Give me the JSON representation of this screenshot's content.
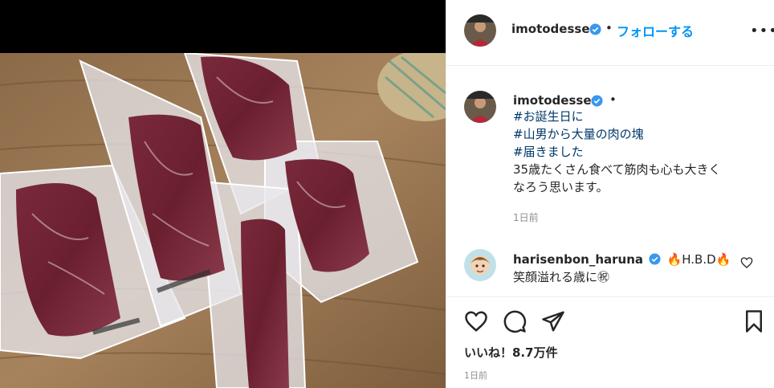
{
  "post": {
    "username": "imotodesse",
    "follow_label": "フォローする",
    "separator": "•",
    "more_label": "•••"
  },
  "caption": {
    "username": "imotodesse",
    "separator": "•",
    "hashtags": [
      "#お誕生日に",
      "#山男から大量の肉の塊",
      "#届きました"
    ],
    "body_lines": [
      "35歳たくさん食べて筋肉も心も大きく",
      "なろう思います。"
    ],
    "time": "1日前"
  },
  "comment": {
    "username": "harisenbon_haruna",
    "text": "🔥H.B.D🔥",
    "text_line2": "笑顔溢れる歳に㊗"
  },
  "footer": {
    "likes": "いいね！8.7万件",
    "date": "1日前"
  },
  "colors": {
    "accent": "#0095f6",
    "verified": "#3897f0",
    "hashtag": "#00376b",
    "muted": "#8e8e8e"
  },
  "icons": {
    "verified": "verified-badge-icon",
    "heart": "heart-icon",
    "comment": "comment-icon",
    "share": "share-icon",
    "bookmark": "bookmark-icon"
  }
}
